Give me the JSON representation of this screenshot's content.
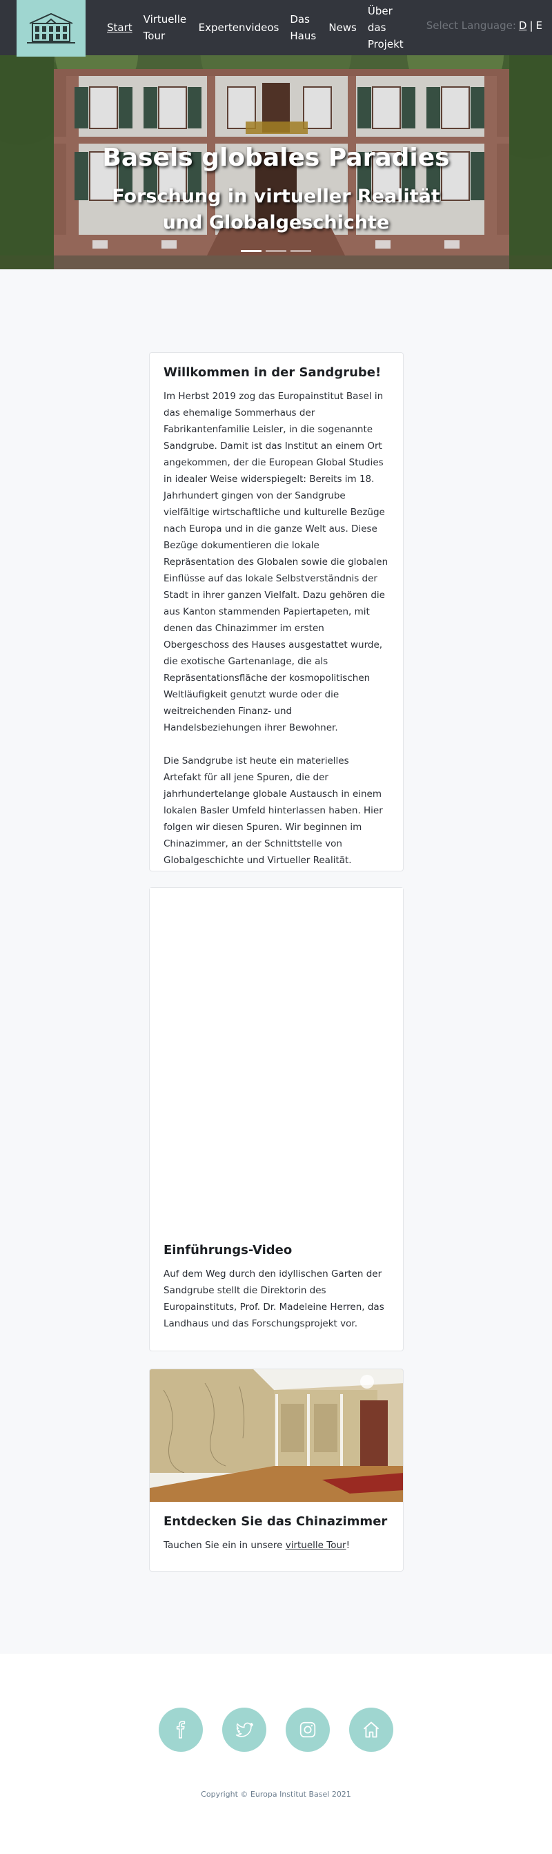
{
  "nav": {
    "logo_alt": "Europainstitut Basel",
    "links": [
      {
        "label": "Start",
        "active": true
      },
      {
        "label": "Virtuelle Tour"
      },
      {
        "label": "Expertenvideos"
      },
      {
        "label": "Das Haus"
      },
      {
        "label": "News"
      },
      {
        "label": "Über das Projekt"
      }
    ],
    "language": {
      "prompt": "Select Language:",
      "options": [
        "D",
        "E"
      ],
      "separator": "|",
      "active": "D"
    }
  },
  "hero": {
    "title": "Basels globales Paradies",
    "subtitle": "Forschung in virtueller Realität und Globalgeschichte",
    "slides_count": 3,
    "active_slide": 1
  },
  "welcome": {
    "title": "Willkommen in der Sandgrube!",
    "paragraphs": [
      "Im Herbst 2019 zog das Europainstitut Basel in das ehemalige Sommerhaus der Fabrikantenfamilie Leisler, in die sogenannte Sandgrube. Damit ist das Institut an einem Ort angekommen, der die European Global Studies in idealer Weise widerspiegelt: Bereits im 18. Jahrhundert gingen von der Sandgrube vielfältige wirtschaftliche und kulturelle Bezüge nach Europa und in die ganze Welt aus. Diese Bezüge dokumentieren die lokale Repräsentation des Globalen sowie die globalen Einflüsse auf das lokale Selbstverständnis der Stadt in ihrer ganzen Vielfalt. Dazu gehören die aus Kanton stammenden Papiertapeten, mit denen das Chinazimmer im ersten Obergeschoss des Hauses ausgestattet wurde, die exotische Gartenanlage, die als Repräsentationsfläche der kosmopolitischen Weltläufigkeit genutzt wurde oder die weitreichenden Finanz- und Handelsbeziehungen ihrer Bewohner.",
      "Die Sandgrube ist heute ein materielles Artefakt für all jene Spuren, die der jahrhundertelange globale Austausch in einem lokalen Basler Umfeld hinterlassen haben. Hier folgen wir diesen Spuren. Wir beginnen im Chinazimmer, an der Schnittstelle von Globalgeschichte und Virtueller Realität."
    ]
  },
  "video": {
    "title": "Einführungs-Video",
    "text": "Auf dem Weg durch den idyllischen Garten der Sandgrube stellt die Direktorin des Europainstituts, Prof. Dr. Madeleine Herren, das Landhaus und das Forschungsprojekt vor."
  },
  "china": {
    "title": "Entdecken Sie das Chinazimmer",
    "text_before": "Tauchen Sie ein in unsere ",
    "link_label": "virtuelle Tour",
    "text_after": "!"
  },
  "footer": {
    "social": [
      {
        "name": "facebook-icon"
      },
      {
        "name": "twitter-icon"
      },
      {
        "name": "instagram-icon"
      },
      {
        "name": "home-icon"
      }
    ],
    "copyright": "Copyright © Europa Institut Basel 2021"
  },
  "colors": {
    "nav_bg": "#33363d",
    "accent": "#9fd6d0",
    "page_bg": "#f7f8fa"
  }
}
